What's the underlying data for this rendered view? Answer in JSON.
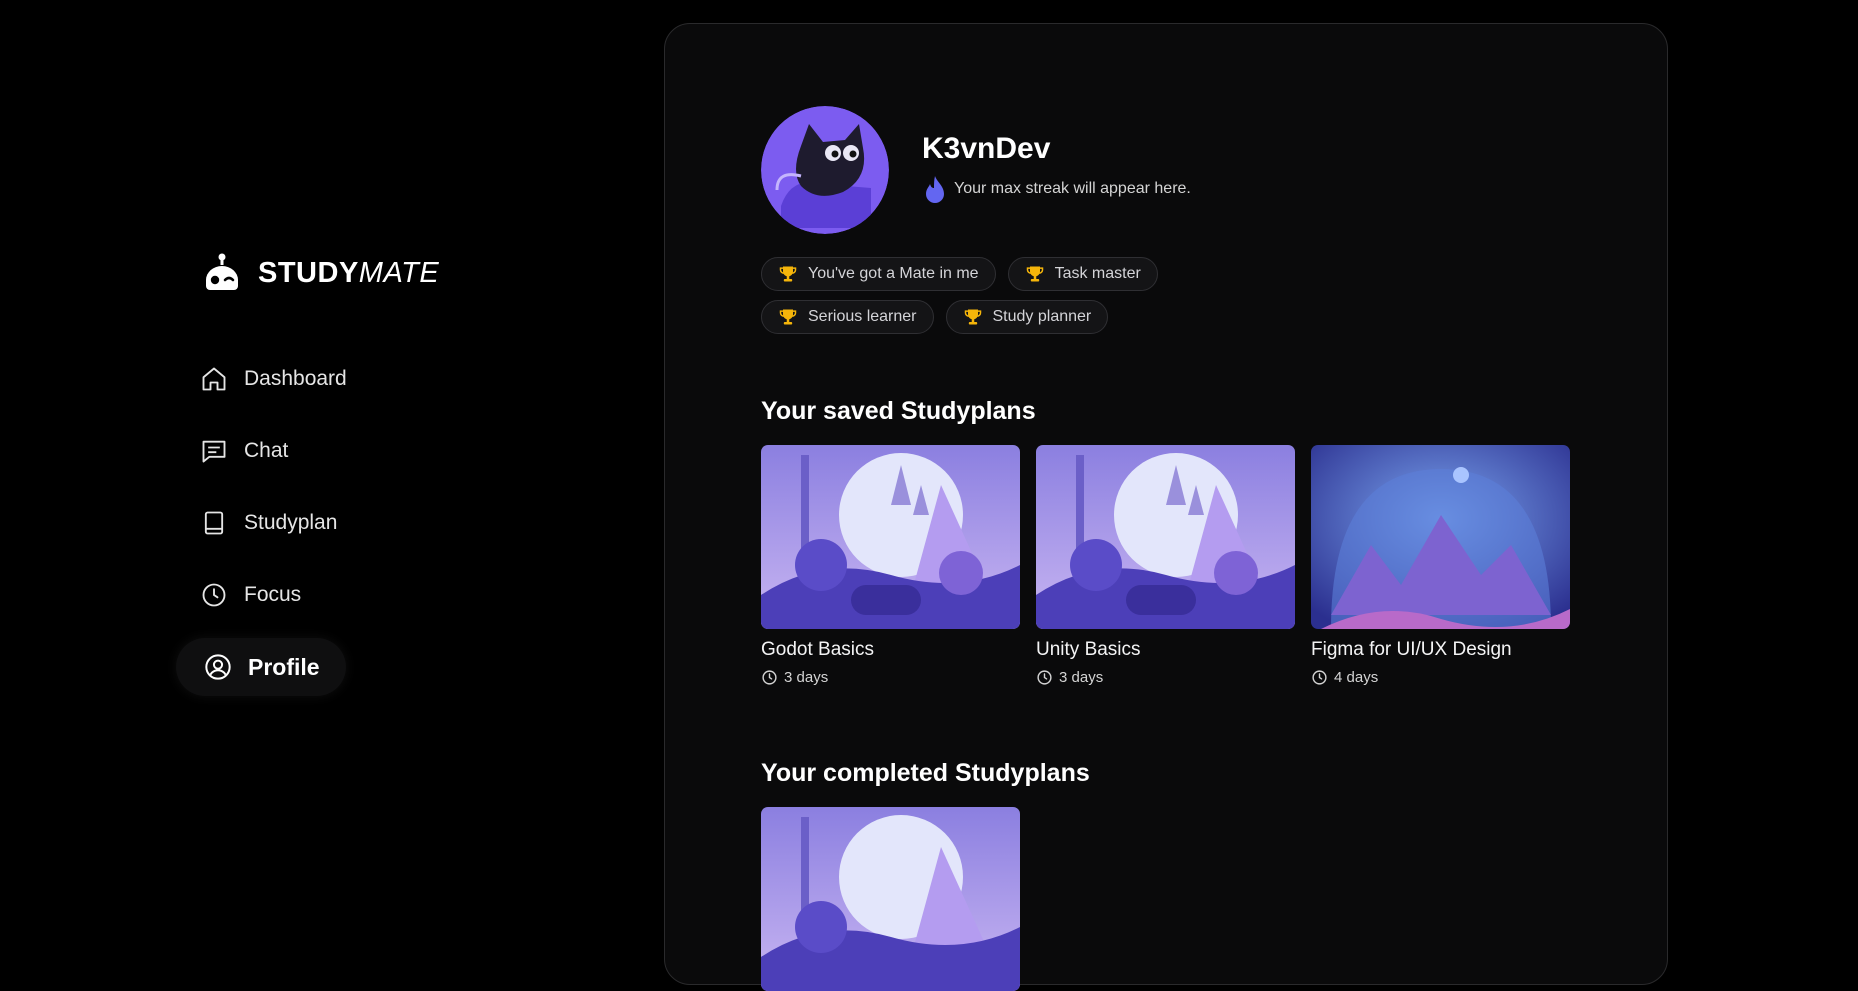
{
  "brand": {
    "bold": "STUDY",
    "italic": "MATE"
  },
  "nav": [
    {
      "label": "Dashboard",
      "icon": "home-icon"
    },
    {
      "label": "Chat",
      "icon": "chat-icon"
    },
    {
      "label": "Studyplan",
      "icon": "book-icon"
    },
    {
      "label": "Focus",
      "icon": "clock-icon"
    },
    {
      "label": "Profile",
      "icon": "user-circle-icon",
      "active": true
    }
  ],
  "profile": {
    "username": "K3vnDev",
    "streak_text": "Your max streak will appear here.",
    "badges": [
      "You've got a Mate in me",
      "Task master",
      "Serious learner",
      "Study planner"
    ]
  },
  "saved": {
    "title": "Your saved Studyplans",
    "items": [
      {
        "name": "Godot Basics",
        "duration": "3 days"
      },
      {
        "name": "Unity Basics",
        "duration": "3 days"
      },
      {
        "name": "Figma for UI/UX Design",
        "duration": "4 days"
      }
    ]
  },
  "completed": {
    "title": "Your completed Studyplans"
  },
  "colors": {
    "accent": "#6366f1",
    "trophy": "#f5b50a",
    "panel": "#0a0a0b"
  }
}
